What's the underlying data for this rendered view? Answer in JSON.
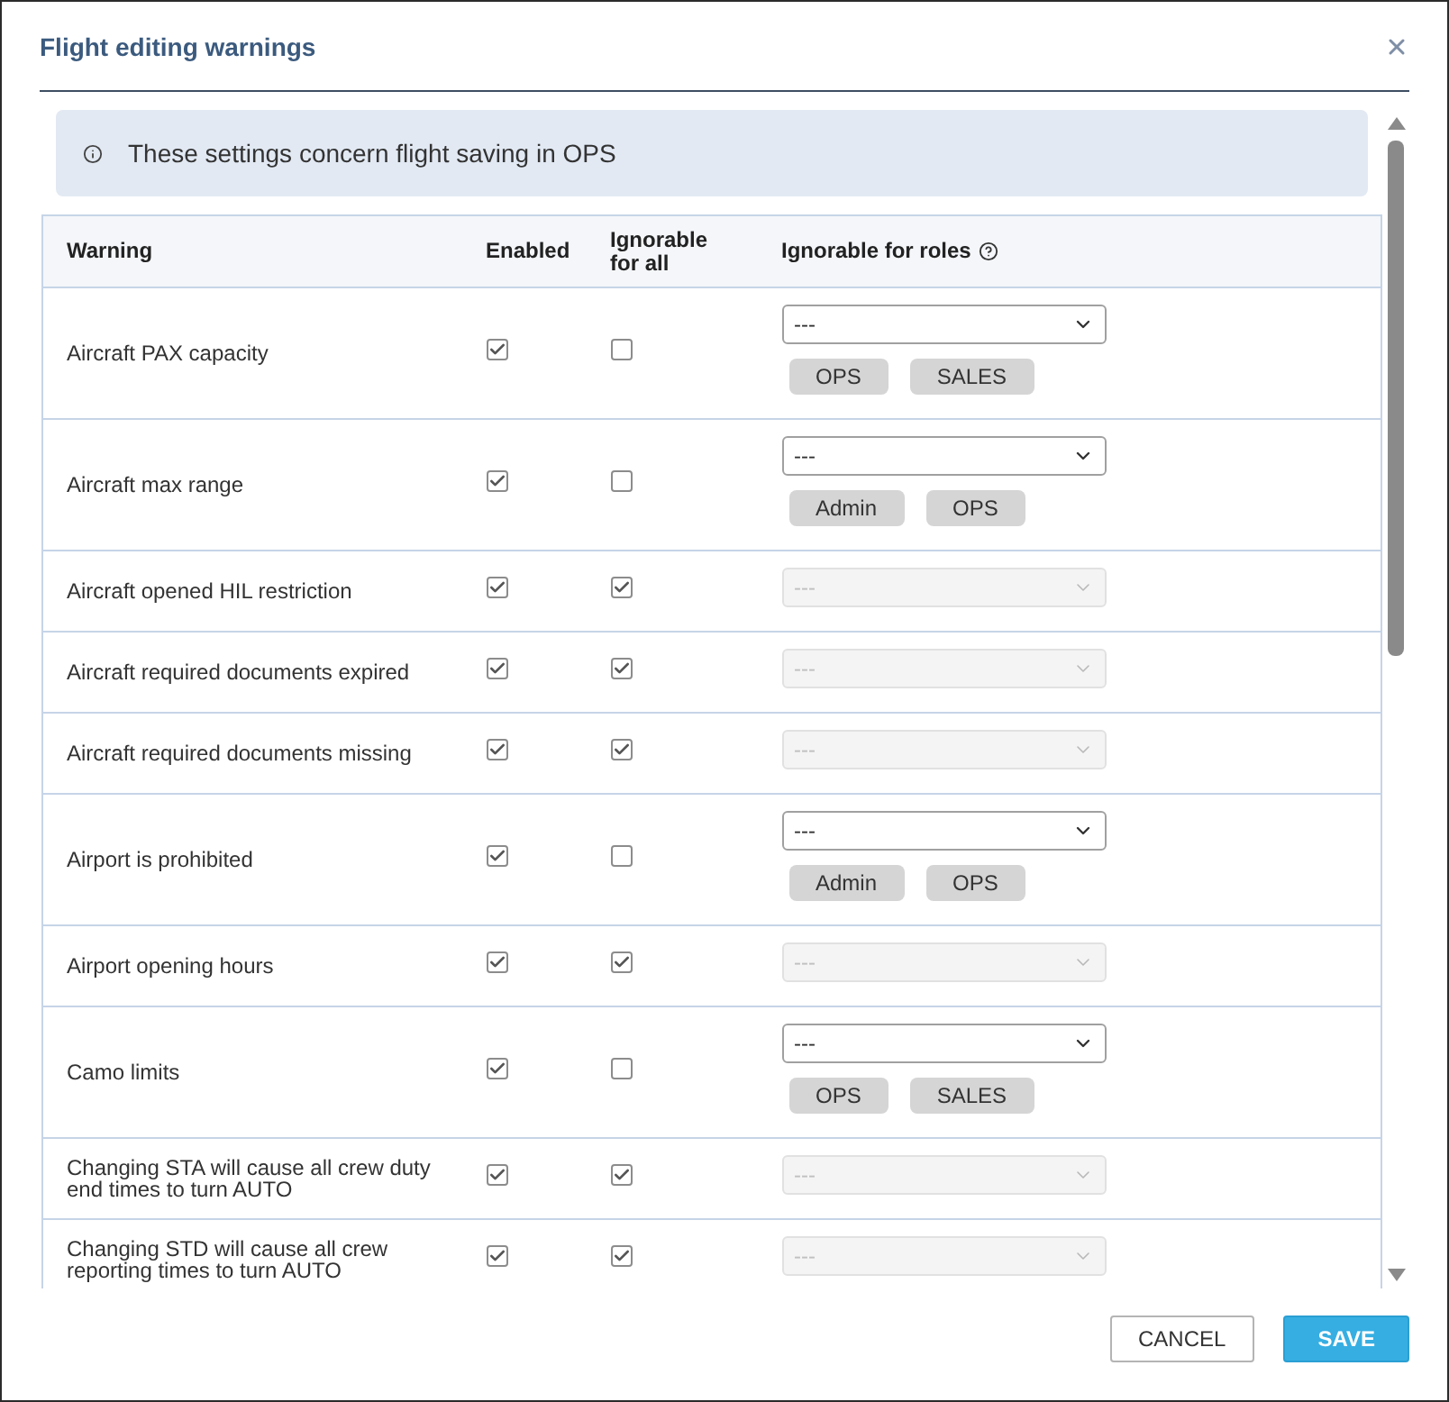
{
  "dialog": {
    "title": "Flight editing warnings"
  },
  "info": {
    "text": "These settings concern flight saving in OPS"
  },
  "table": {
    "columns": [
      "Warning",
      "Enabled",
      "Ignorable for all",
      "Ignorable for roles"
    ],
    "rows": [
      {
        "warning": "Aircraft PAX capacity",
        "enabled": true,
        "ignorable_for_all": false,
        "roles_select": {
          "value": "---",
          "disabled": false
        },
        "roles": [
          "OPS",
          "SALES"
        ]
      },
      {
        "warning": "Aircraft max range",
        "enabled": true,
        "ignorable_for_all": false,
        "roles_select": {
          "value": "---",
          "disabled": false
        },
        "roles": [
          "Admin",
          "OPS"
        ]
      },
      {
        "warning": "Aircraft opened HIL restriction",
        "enabled": true,
        "ignorable_for_all": true,
        "roles_select": {
          "value": "---",
          "disabled": true
        }
      },
      {
        "warning": "Aircraft required documents expired",
        "enabled": true,
        "ignorable_for_all": true,
        "roles_select": {
          "value": "---",
          "disabled": true
        }
      },
      {
        "warning": "Aircraft required documents missing",
        "enabled": true,
        "ignorable_for_all": true,
        "roles_select": {
          "value": "---",
          "disabled": true
        }
      },
      {
        "warning": "Airport is prohibited",
        "enabled": true,
        "ignorable_for_all": false,
        "roles_select": {
          "value": "---",
          "disabled": false
        },
        "roles": [
          "Admin",
          "OPS"
        ]
      },
      {
        "warning": "Airport opening hours",
        "enabled": true,
        "ignorable_for_all": true,
        "roles_select": {
          "value": "---",
          "disabled": true
        }
      },
      {
        "warning": "Camo limits",
        "enabled": true,
        "ignorable_for_all": false,
        "roles_select": {
          "value": "---",
          "disabled": false
        },
        "roles": [
          "OPS",
          "SALES"
        ]
      },
      {
        "warning": "Changing STA will cause all crew duty end times to turn AUTO",
        "enabled": true,
        "ignorable_for_all": true,
        "roles_select": {
          "value": "---",
          "disabled": true
        }
      },
      {
        "warning": "Changing STD will cause all crew reporting times to turn AUTO",
        "enabled": true,
        "ignorable_for_all": true,
        "roles_select": {
          "value": "---",
          "disabled": true
        }
      }
    ]
  },
  "footer": {
    "buttons": [
      {
        "label": "CANCEL",
        "kind": "secondary"
      },
      {
        "label": "SAVE",
        "kind": "primary"
      }
    ]
  }
}
